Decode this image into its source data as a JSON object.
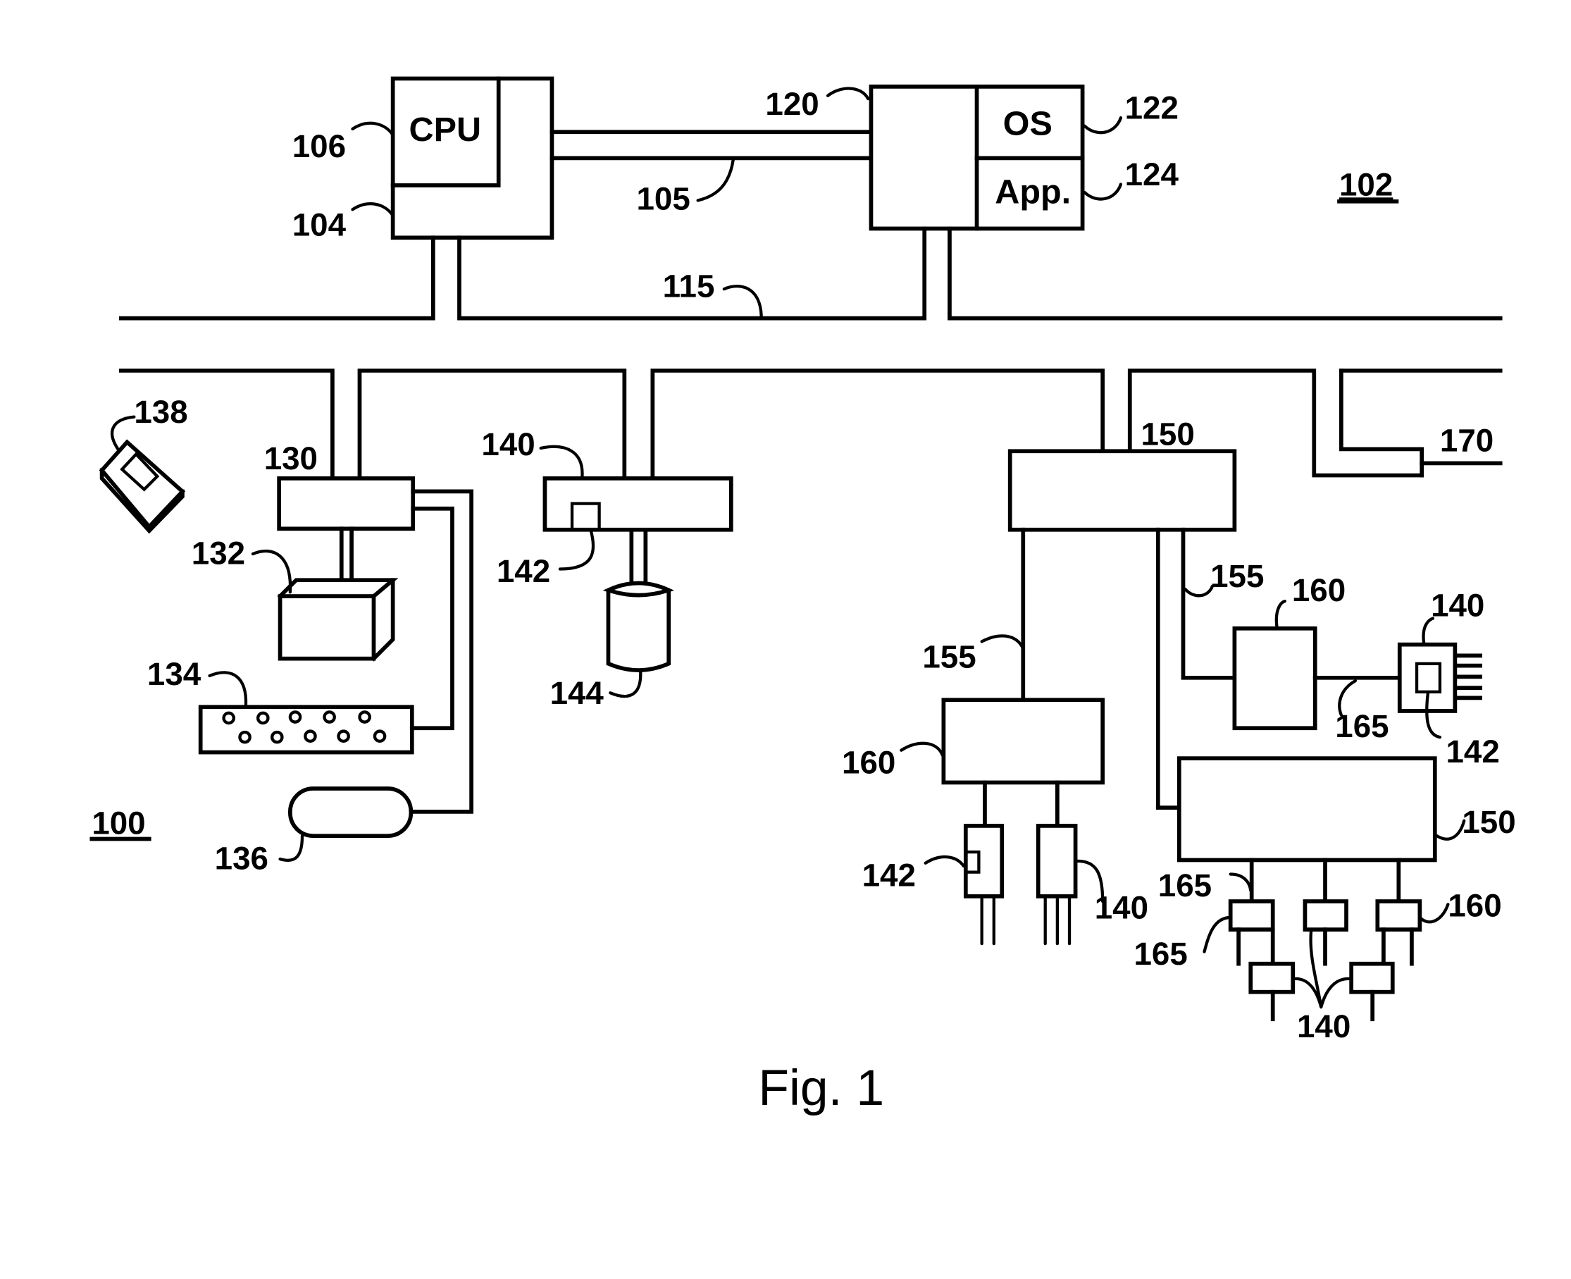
{
  "figure": {
    "caption": "Fig. 1",
    "system_label": "100",
    "computer_label": "102"
  },
  "components": {
    "cpu_text": "CPU",
    "os_text": "OS",
    "app_text": "App."
  },
  "reference_numerals": {
    "r104": "104",
    "r105": "105",
    "r106": "106",
    "r115": "115",
    "r120": "120",
    "r122": "122",
    "r124": "124",
    "r130": "130",
    "r132": "132",
    "r134": "134",
    "r136": "136",
    "r138": "138",
    "r140_a": "140",
    "r142_a": "142",
    "r144": "144",
    "r150_a": "150",
    "r170": "170",
    "r155_a": "155",
    "r160_a": "160",
    "r140_b": "140",
    "r165_a": "165",
    "r142_b": "142",
    "r155_b": "155",
    "r160_b": "160",
    "r142_c": "142",
    "r140_c": "140",
    "r150_b": "150",
    "r165_b": "165",
    "r165_c": "165",
    "r160_c": "160",
    "r140_d": "140"
  }
}
